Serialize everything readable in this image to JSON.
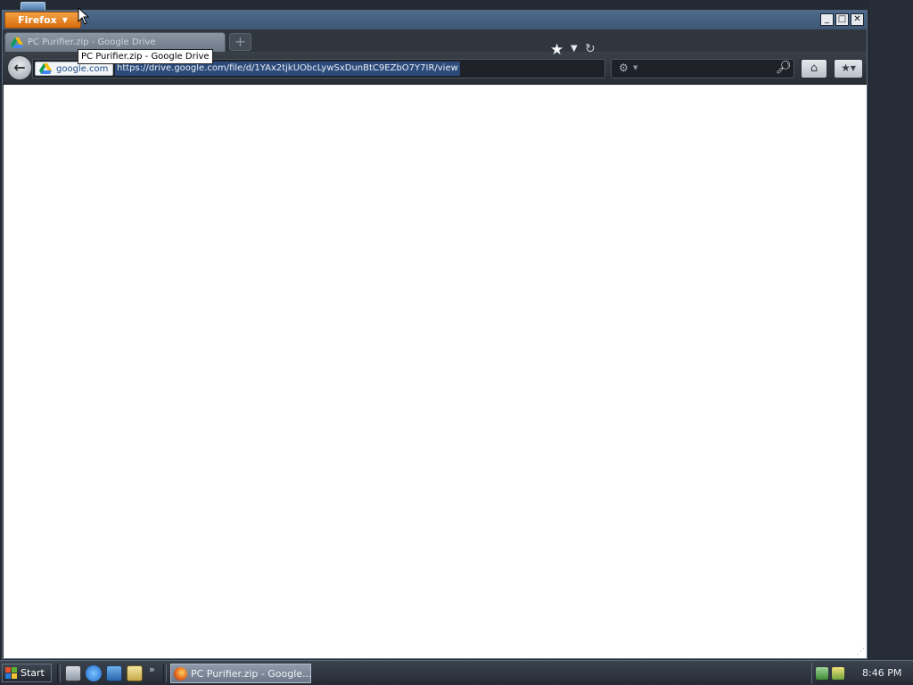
{
  "browser": {
    "menu_label": "Firefox",
    "tab": {
      "title": "PC Purifier.zip - Google Drive"
    },
    "newtab_label": "+",
    "identity_label": "google.com",
    "url": "https://drive.google.com/file/d/1YAx2tjkUObcLywSxDunBtC9EZbO7Y7IR/view",
    "tooltip": "PC Purifier.zip - Google Drive",
    "window_controls": {
      "minimize": "_",
      "maximize": "□",
      "close": "✕"
    },
    "icons": {
      "back": "arrow-left-icon",
      "star": "bookmark-star-icon",
      "dropdown": "chevron-down-icon",
      "reload": "reload-icon",
      "search_engine": "search-engine-icon",
      "search_go": "magnifier-icon",
      "home": "home-icon",
      "bookmarks": "bookmarks-icon"
    }
  },
  "taskbar": {
    "start_label": "Start",
    "quick_launch": [
      "show-desktop-icon",
      "internet-explorer-icon",
      "outlook-express-icon",
      "search-icon"
    ],
    "overflow": "»",
    "task_button_label": "PC Purifier.zip - Google...",
    "tray_icons": [
      "network-icon",
      "security-icon"
    ],
    "clock": "8:46 PM"
  },
  "colors": {
    "firefox_button": "#e2801f",
    "window_chrome": "#2a2f37",
    "titlebar": "#44607f",
    "content_background": "#ffffff",
    "taskbar": "#2f363f"
  }
}
